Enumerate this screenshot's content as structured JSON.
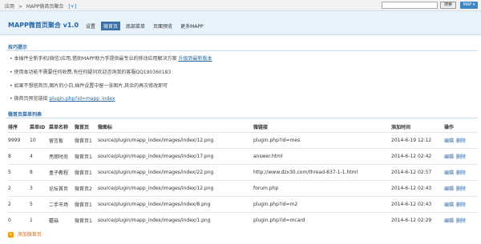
{
  "topbar": {
    "crumb_app": "应用",
    "crumb_sep": ">",
    "crumb_page": "MAPP微首页聚合",
    "crumb_add": "[+]",
    "search_button": "搜索",
    "map_button": "MAP ▾"
  },
  "header": {
    "title": "MAPP微首页聚合 v1.0",
    "tabs": [
      "设置",
      "微首页",
      "底部菜单",
      "页面预览",
      "更多MAPP"
    ]
  },
  "tips": {
    "heading": "技巧提示",
    "items": [
      "• 本插件全新手机(微信)应用,借助MAPP助力手提供最专业的移动应用解决方案",
      "• 使用本功能不需要任何收费,有任何疑问欢迎咨询我的客服QQ190360183",
      "• 如果不想搭首页,图片的小白,插件设置中留一张图片,其余的再次修改即可",
      "• 微首页预览链接"
    ],
    "item1_link": "升级到最新版本",
    "preview_link": "plugin.php?id=mapp_index"
  },
  "table": {
    "heading": "微首页菜单列表",
    "headers": [
      "排序",
      "菜单ID",
      "菜单名称",
      "微首页",
      "微图标",
      "",
      "微链接",
      "",
      "添加时间",
      "操作"
    ],
    "rows": [
      [
        "9999",
        "10",
        "留言板",
        "微首页1",
        "source/plugin/mapp_index/images/index/12.png",
        "plugin.php?id=mes",
        "2014-6-19 12:12"
      ],
      [
        "8",
        "4",
        "亮丽时尚",
        "微首页1",
        "source/plugin/mapp_index/images/index/17.png",
        "answer.html",
        "2014-6-12 02:42"
      ],
      [
        "5",
        "8",
        "盒子教程",
        "微首页1",
        "source/plugin/mapp_index/images/index/22.png",
        "http://www.dzx30.com/thread-837-1-1.html",
        "2014-6-12 02:57"
      ],
      [
        "2",
        "3",
        "论坛首页",
        "微首页2",
        "source/plugin/mapp_index/images/index/12.png",
        "forum.php",
        "2014-6-12 02:43"
      ],
      [
        "2",
        "5",
        "二手市场",
        "微首页1",
        "source/plugin/mapp_index/images/index/8.png",
        "plugin.php?id=m2",
        "2014-6-12 02:43"
      ],
      [
        "0",
        "1",
        "蘑菇",
        "微首页1",
        "source/plugin/mapp_index/images/index/1.png",
        "plugin.php?id=mcard",
        "2014-6-12 02:29"
      ]
    ],
    "edit": "编辑",
    "delete": "删除"
  },
  "add_label": "添加微首页"
}
